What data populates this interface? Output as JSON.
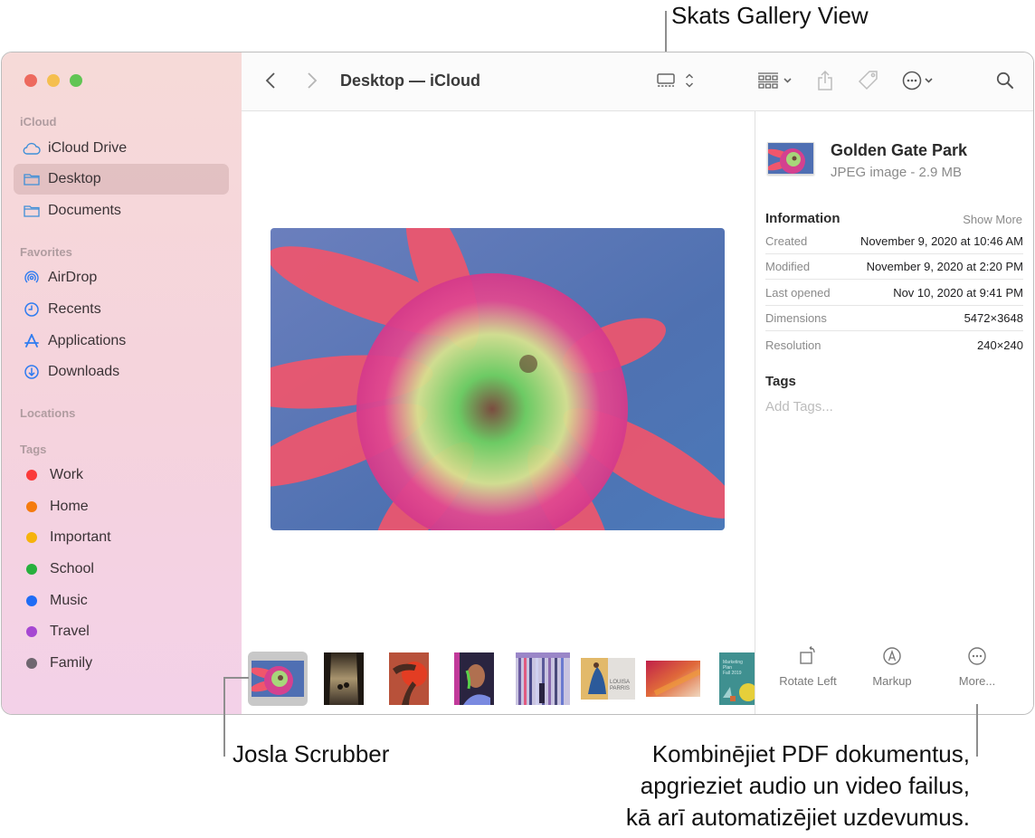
{
  "callouts": {
    "gallery_view": "Skats Gallery View",
    "scrubber": "Josla Scrubber",
    "more_lines": [
      "Kombinējiet PDF dokumentus,",
      "apgrieziet audio un video failus,",
      "kā arī automatizējiet uzdevumus."
    ]
  },
  "window": {
    "traffic_colors": {
      "close": "#ed6a5e",
      "minimize": "#f5bf4f",
      "zoom": "#61c554"
    }
  },
  "sidebar": {
    "sections": {
      "icloud": "iCloud",
      "favorites": "Favorites",
      "locations": "Locations",
      "tags": "Tags"
    },
    "icloud_items": [
      {
        "label": "iCloud Drive",
        "icon": "cloud-icon"
      },
      {
        "label": "Desktop",
        "icon": "folder-icon",
        "selected": true
      },
      {
        "label": "Documents",
        "icon": "folder-icon"
      }
    ],
    "favorite_items": [
      {
        "label": "AirDrop",
        "icon": "airdrop-icon"
      },
      {
        "label": "Recents",
        "icon": "clock-icon"
      },
      {
        "label": "Applications",
        "icon": "applications-icon"
      },
      {
        "label": "Downloads",
        "icon": "download-icon"
      }
    ],
    "tags": [
      {
        "label": "Work",
        "color": "#fb3a3a"
      },
      {
        "label": "Home",
        "color": "#f57b0e"
      },
      {
        "label": "Important",
        "color": "#f6b30c"
      },
      {
        "label": "School",
        "color": "#27b03d"
      },
      {
        "label": "Music",
        "color": "#1f6cf5"
      },
      {
        "label": "Travel",
        "color": "#a647d2"
      },
      {
        "label": "Family",
        "color": "#6f6770"
      }
    ]
  },
  "toolbar": {
    "title": "Desktop — iCloud",
    "icons": [
      "back-icon",
      "forward-icon",
      "gallery-view-icon",
      "view-options-chevron-icon",
      "group-icon",
      "share-icon",
      "tag-icon",
      "action-menu-icon",
      "search-icon"
    ]
  },
  "gallery": {
    "thumbnails": [
      "Golden Gate Park",
      "forest-path",
      "red-hands",
      "portrait-neon",
      "light-columns",
      "louisa-parris",
      "gradient-abstract",
      "marketing-plan"
    ],
    "selected_index": 0,
    "thumb_texts": {
      "louisa": "LOUISA PARRIS",
      "marketing": "Marketing Plan Fall 2019"
    }
  },
  "inspector": {
    "file_name": "Golden Gate Park",
    "file_kind": "JPEG image - 2.9 MB",
    "information_label": "Information",
    "show_more": "Show More",
    "rows": [
      {
        "key": "Created",
        "value": "November 9, 2020 at 10:46 AM"
      },
      {
        "key": "Modified",
        "value": "November 9, 2020 at 2:20 PM"
      },
      {
        "key": "Last opened",
        "value": "Nov 10, 2020 at 9:41 PM"
      },
      {
        "key": "Dimensions",
        "value": "5472×3648"
      },
      {
        "key": "Resolution",
        "value": "240×240"
      }
    ],
    "tags_label": "Tags",
    "tags_placeholder": "Add Tags...",
    "actions": [
      {
        "label": "Rotate Left",
        "icon": "rotate-left-icon"
      },
      {
        "label": "Markup",
        "icon": "markup-icon"
      },
      {
        "label": "More...",
        "icon": "more-icon"
      }
    ]
  }
}
